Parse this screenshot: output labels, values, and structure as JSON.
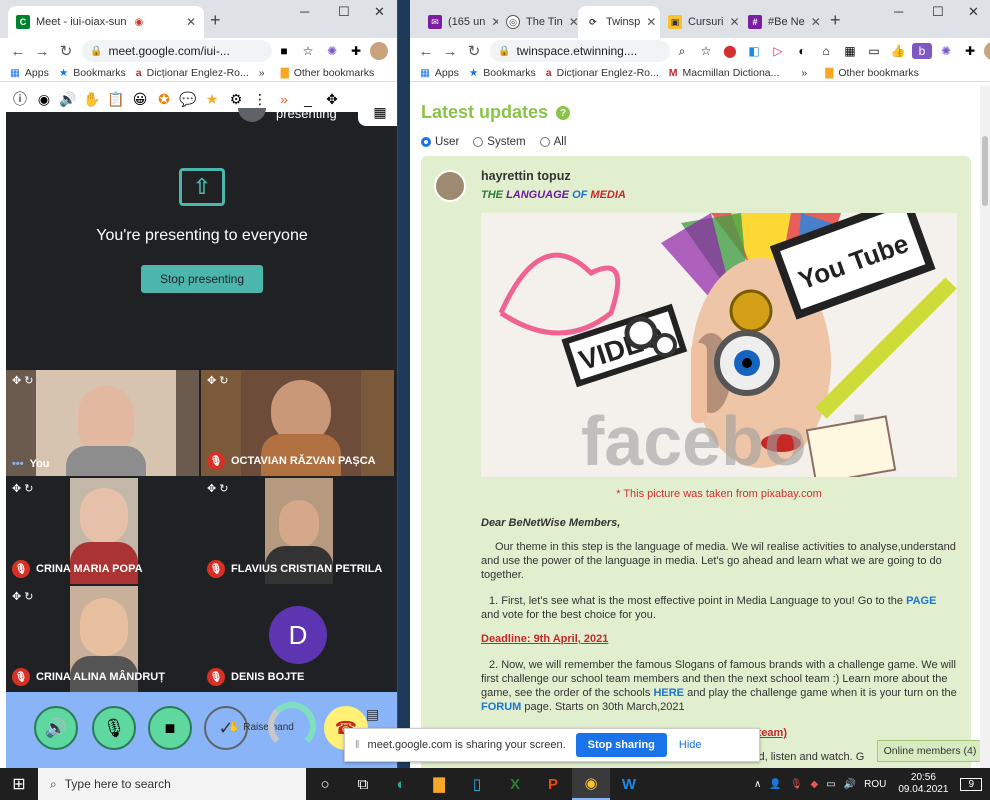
{
  "left_window": {
    "tab": {
      "title": "Meet - iui-oiax-sun"
    },
    "url": "meet.google.com/iui-...",
    "bookmarks": [
      {
        "label": "Apps"
      },
      {
        "label": "Bookmarks"
      },
      {
        "label": "Dicționar Englez-Ro..."
      },
      {
        "label": "»"
      },
      {
        "label": "Other bookmarks"
      }
    ],
    "meet": {
      "top_label": "presenting",
      "presenting_title": "You're presenting to everyone",
      "stop_label": "Stop presenting",
      "participants": [
        {
          "name": "You",
          "muted": false
        },
        {
          "name": "OCTAVIAN RĂZVAN PAȘCA",
          "muted": true
        },
        {
          "name": "CRINA MARIA POPA",
          "muted": true
        },
        {
          "name": "FLAVIUS CRISTIAN PETRILA",
          "muted": true
        },
        {
          "name": "CRINA ALINA MÂNDRUȚ",
          "muted": true
        },
        {
          "name": "DENIS BOJTE",
          "muted": true,
          "initial": "D"
        }
      ],
      "raise_hand": "Raise hand"
    },
    "share_bar": {
      "text": "meet.google.com is sharing your screen.",
      "stop": "Stop sharing",
      "hide": "Hide"
    }
  },
  "right_window": {
    "tabs": [
      {
        "title": "(165 un"
      },
      {
        "title": "The Tin"
      },
      {
        "title": "Twinsp"
      },
      {
        "title": "Cursuri"
      },
      {
        "title": "#Be Ne"
      }
    ],
    "url": "twinspace.etwinning....",
    "bookmarks": [
      {
        "label": "Apps"
      },
      {
        "label": "Bookmarks"
      },
      {
        "label": "Dicționar Englez-Ro..."
      },
      {
        "label": "Macmillan Dictiona..."
      },
      {
        "label": "»"
      },
      {
        "label": "Other bookmarks"
      }
    ],
    "page": {
      "heading": "Latest updates",
      "filters": [
        {
          "label": "User",
          "checked": true
        },
        {
          "label": "System",
          "checked": false
        },
        {
          "label": "All",
          "checked": false
        }
      ],
      "post": {
        "user": "hayrettin topuz",
        "title_words": [
          "THE",
          "LANGUAGE",
          "OF",
          "MEDIA"
        ],
        "picture_credit": "* This picture was taken from pixabay.com",
        "greeting": "Dear BeNetWise Members,",
        "p1": "Our theme in this step is the language of media. We wil realise activities to analyse,understand and use the power of the language in media. Let's go ahead and learn what we are going to do together.",
        "p2a": "1. First, let's see what is the most effective point in Media Language to you! Go to the",
        "p2link": "PAGE",
        "p2b": "and vote for the best choice for you.",
        "deadline1": "Deadline: 9th April, 2021",
        "p3a": "2. Now, we will remember the famous Slogans of famous brands with a challenge game. We will first challenge our school team members and then the next school team :) Learn more about the game, see the order of the schools",
        "p3link": "HERE",
        "p3b": "and play the challenge game when it is your turn on the",
        "p3link2": "FORUM",
        "p3c": "page. Starts on 30th March,2021",
        "deadline2_tail": "y for each school team)",
        "p4_tail": "the news that we read, listen and watch. G"
      },
      "online": "Online members (4)"
    },
    "image_words": {
      "tube": "You Tube",
      "video": "VIDEO",
      "face": "facebook"
    }
  },
  "taskbar": {
    "search_placeholder": "Type here to search",
    "lang": "ROU",
    "time": "20:56",
    "date": "09.04.2021",
    "notif": "9"
  }
}
